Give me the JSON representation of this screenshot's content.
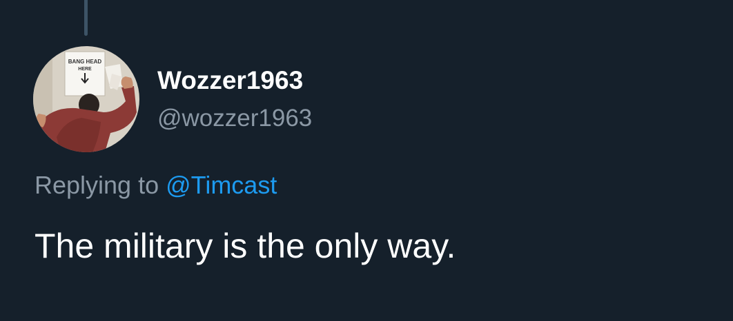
{
  "tweet": {
    "author": {
      "display_name": "Wozzer1963",
      "handle": "@wozzer1963",
      "avatar": {
        "icon": "avatar-photo",
        "sign_line1": "BANG HEAD",
        "sign_line2": "HERE"
      }
    },
    "reply": {
      "prefix": "Replying to",
      "mention": "@Timcast"
    },
    "text": "The military is the only way."
  },
  "colors": {
    "background": "#15202b",
    "primary_text": "#ffffff",
    "secondary_text": "#8b98a5",
    "accent": "#1d9bf0",
    "thread_line": "#3d5466"
  }
}
